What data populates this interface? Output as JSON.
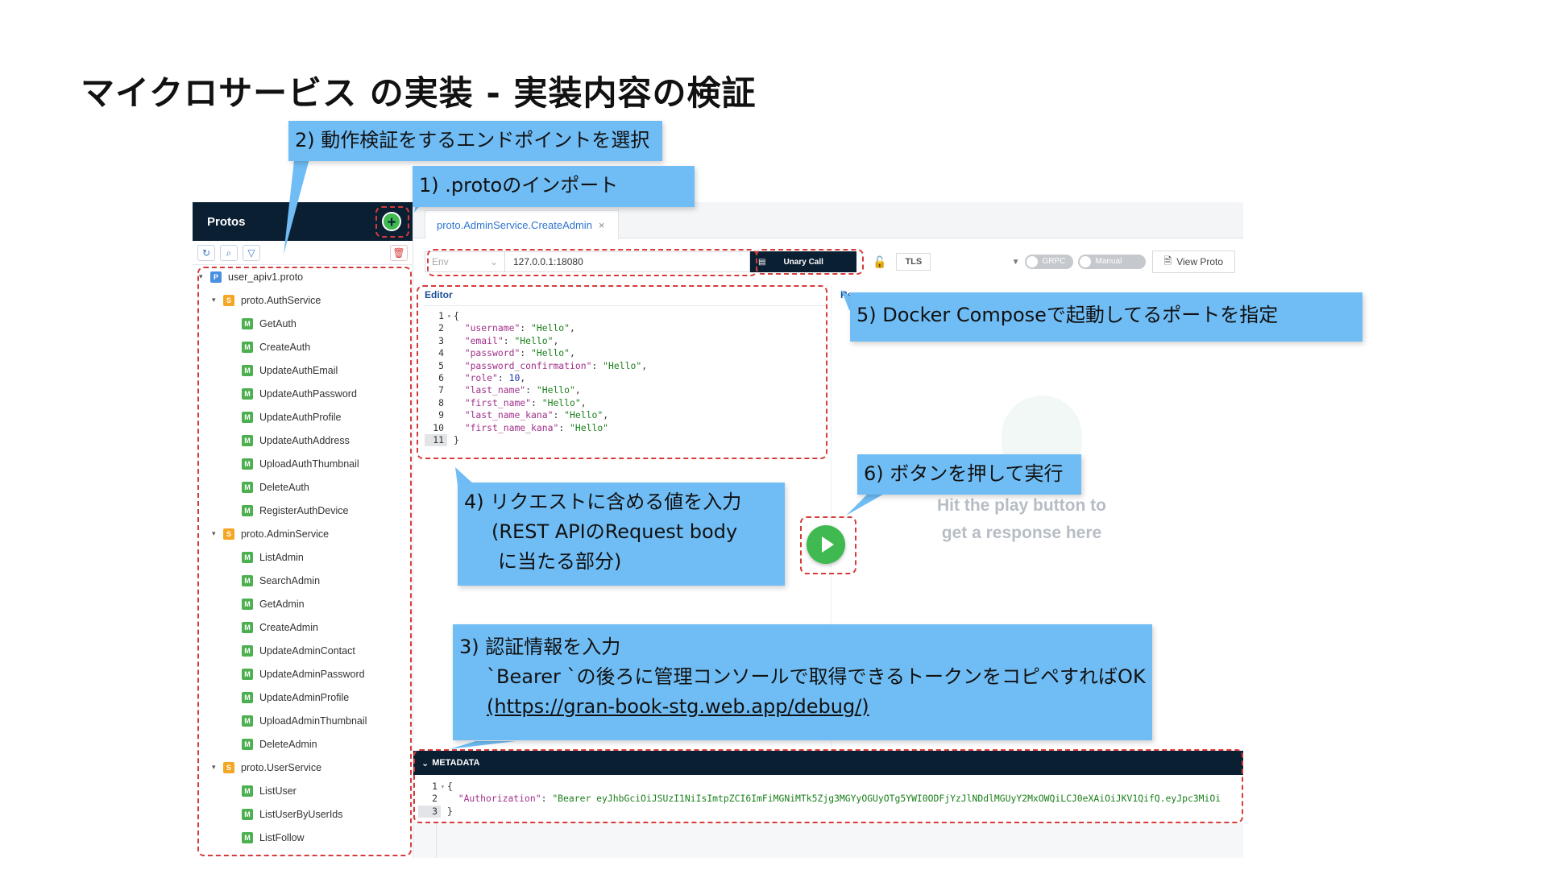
{
  "slide": {
    "title": "マイクロサービス の実装 - 実装内容の検証"
  },
  "sidebar": {
    "title": "Protos",
    "add_icon": "plus-icon",
    "tools": [
      "refresh-icon",
      "search-icon",
      "filter-icon"
    ],
    "trash_icon": "trash-icon",
    "file": "user_apiv1.proto",
    "services": [
      {
        "name": "proto.AuthService",
        "methods": [
          "GetAuth",
          "CreateAuth",
          "UpdateAuthEmail",
          "UpdateAuthPassword",
          "UpdateAuthProfile",
          "UpdateAuthAddress",
          "UploadAuthThumbnail",
          "DeleteAuth",
          "RegisterAuthDevice"
        ]
      },
      {
        "name": "proto.AdminService",
        "methods": [
          "ListAdmin",
          "SearchAdmin",
          "GetAdmin",
          "CreateAdmin",
          "UpdateAdminContact",
          "UpdateAdminPassword",
          "UpdateAdminProfile",
          "UploadAdminThumbnail",
          "DeleteAdmin"
        ]
      },
      {
        "name": "proto.UserService",
        "methods": [
          "ListUser",
          "ListUserByUserIds",
          "ListFollow"
        ]
      }
    ]
  },
  "main": {
    "tab_label": "proto.AdminService.CreateAdmin",
    "env_placeholder": "Env",
    "url": "127.0.0.1:18080",
    "call_type": "Unary Call",
    "tls_label": "TLS",
    "grpc_label": "GRPC",
    "manual_label": "Manual",
    "view_proto_label": "View Proto",
    "editor_label": "Editor",
    "response_label": "Re",
    "response_placeholder_line1": "Hit the play button to",
    "response_placeholder_line2": "get a response here",
    "metadata_label": "METADATA"
  },
  "editor_lines": [
    {
      "ln": "1",
      "fold": "▾",
      "text": "{"
    },
    {
      "ln": "2",
      "key": "\"username\"",
      "val": "\"Hello\"",
      "type": "s",
      "end": ","
    },
    {
      "ln": "3",
      "key": "\"email\"",
      "val": "\"Hello\"",
      "type": "s",
      "end": ","
    },
    {
      "ln": "4",
      "key": "\"password\"",
      "val": "\"Hello\"",
      "type": "s",
      "end": ","
    },
    {
      "ln": "5",
      "key": "\"password_confirmation\"",
      "val": "\"Hello\"",
      "type": "s",
      "end": ","
    },
    {
      "ln": "6",
      "key": "\"role\"",
      "val": "10",
      "type": "n",
      "end": ","
    },
    {
      "ln": "7",
      "key": "\"last_name\"",
      "val": "\"Hello\"",
      "type": "s",
      "end": ","
    },
    {
      "ln": "8",
      "key": "\"first_name\"",
      "val": "\"Hello\"",
      "type": "s",
      "end": ","
    },
    {
      "ln": "9",
      "key": "\"last_name_kana\"",
      "val": "\"Hello\"",
      "type": "s",
      "end": ","
    },
    {
      "ln": "10",
      "key": "\"first_name_kana\"",
      "val": "\"Hello\"",
      "type": "s",
      "end": ""
    },
    {
      "ln": "11",
      "text": "}",
      "active": true
    }
  ],
  "metadata_lines": [
    {
      "ln": "1",
      "fold": "▾",
      "text": "{"
    },
    {
      "ln": "2",
      "key": "\"Authorization\"",
      "val": "\"Bearer eyJhbGciOiJSUzI1NiIsImtpZCI6ImFiMGNiMTk5Zjg3MGYyOGUyOTg5YWI0ODFjYzJlNDdlMGUyY2MxOWQiLCJ0eXAiOiJKV1QifQ.eyJpc3MiOi",
      "type": "s",
      "end": ""
    },
    {
      "ln": "3",
      "text": "}",
      "active": true
    }
  ],
  "callouts": {
    "c1": "1) .protoのインポート",
    "c2": "2) 動作検証をするエンドポイントを選択",
    "c3_line1": "3)  認証情報を入力",
    "c3_line2": "`Bearer `の後ろに管理コンソールで取得できるトークンをコピペすればOK",
    "c3_line3": "(https://gran-book-stg.web.app/debug/)",
    "c4_line1": "4)  リクエストに含める値を入力",
    "c4_line2": "(REST APIのRequest body",
    "c4_line3": "に当たる部分)",
    "c5": "5) Docker Composeで起動してるポートを指定",
    "c6": "6) ボタンを押して実行"
  },
  "colors": {
    "accent_dark": "#0b1f33",
    "callout": "#70bdf5",
    "dashed_highlight": "#d73a3a",
    "play_green": "#3fb950"
  }
}
